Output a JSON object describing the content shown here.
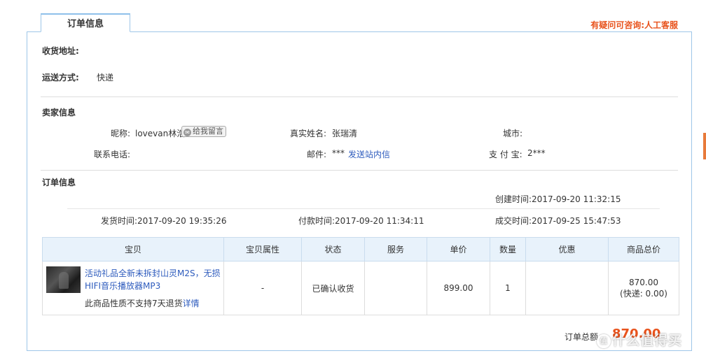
{
  "tab": {
    "label": "订单信息"
  },
  "help_link": "有疑问可咨询:人工客服",
  "shipping": {
    "address_label": "收货地址:",
    "address_value": "",
    "method_label": "运送方式:",
    "method_value": "快递"
  },
  "seller": {
    "section_title": "卖家信息",
    "nickname_label": "昵称:",
    "nickname_value": "lovevan林浩",
    "message_button": "给我留言",
    "realname_label": "真实姓名:",
    "realname_value": "张瑞清",
    "city_label": "城市:",
    "city_value": "",
    "phone_label": "联系电话:",
    "phone_value": "",
    "email_label": "邮件:",
    "email_value": "***",
    "email_link": "发送站内信",
    "alipay_label": "支 付 宝:",
    "alipay_value": "2***"
  },
  "order": {
    "section_title": "订单信息",
    "created": "创建时间:2017-09-20 11:32:15",
    "shipped": "发货时间:2017-09-20 19:35:26",
    "paid": "付款时间:2017-09-20 11:34:11",
    "completed": "成交时间:2017-09-25 15:47:53"
  },
  "table": {
    "headers": [
      "宝贝",
      "宝贝属性",
      "状态",
      "服务",
      "单价",
      "数量",
      "优惠",
      "商品总价"
    ],
    "rows": [
      {
        "title": "活动礼品全新未拆封山灵M2S，无损HIFI音乐播放器MP3",
        "note": "此商品性质不支持7天退货",
        "note_link": "详情",
        "attr": "-",
        "status": "已确认收货",
        "service": "",
        "price": "899.00",
        "qty": "1",
        "discount": "",
        "total": "870.00",
        "shipping_fee": "(快递: 0.00)"
      }
    ]
  },
  "summary": {
    "label": "订单总额",
    "value": "870.00"
  },
  "watermark": {
    "text": "什么值得买",
    "icon": "值"
  }
}
